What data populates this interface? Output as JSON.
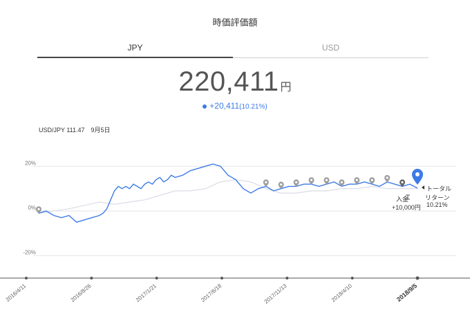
{
  "header": {
    "title": "時価評価額"
  },
  "tabs": [
    {
      "label": "JPY"
    },
    {
      "label": "USD"
    }
  ],
  "valuation": {
    "amount": "220,411",
    "unit": "円",
    "change": "+20,411",
    "change_pct": "(10.21%)"
  },
  "fx_rate": "USD/JPY 111.47　9月5日",
  "annotations": {
    "deposit_label": "入金",
    "deposit_amount": "+10,000円",
    "return_label_1": "トータル",
    "return_label_2": "リターン",
    "return_value": "10.21%"
  },
  "colors": {
    "accent": "#3d7be6",
    "benchmark": "#d9dce6",
    "grid": "#e6e6e6"
  },
  "icons": [
    "location-pin-icon",
    "deposit-icon",
    "arrow-left-icon"
  ],
  "chart_data": {
    "type": "line",
    "ylim": [
      -30,
      30
    ],
    "yticks": [
      "20%",
      "0%",
      "-20%"
    ],
    "ytick_values": [
      20,
      0,
      -20
    ],
    "x_ticks": [
      "2016/4/11",
      "2016/8/26",
      "2017/1/21",
      "2017/6/18",
      "2017/11/13",
      "2018/4/10",
      "2018/9/5"
    ],
    "series": [
      {
        "values_x": [
          0,
          2,
          4,
          6,
          8,
          10,
          12,
          14,
          16,
          17,
          18,
          19,
          20,
          21,
          22,
          23,
          24,
          25,
          26,
          27,
          28,
          29,
          30,
          31,
          32,
          33,
          34,
          35,
          36,
          38,
          40,
          42,
          44,
          46,
          48,
          50,
          52,
          54,
          56,
          58,
          60,
          62,
          64,
          66,
          68,
          70,
          72,
          74,
          76,
          78,
          80,
          82,
          84,
          86,
          88,
          90,
          92,
          94,
          96,
          98,
          100
        ],
        "values": [
          -1,
          0,
          -2,
          -3,
          -2,
          -5,
          -4,
          -3,
          -2,
          -1,
          1,
          5,
          9,
          11,
          10,
          11,
          10,
          12,
          11,
          10,
          12,
          13,
          12,
          14,
          15,
          13,
          14,
          16,
          15,
          16,
          18,
          19,
          20,
          21,
          20,
          16,
          14,
          10,
          8,
          10,
          11,
          9,
          10,
          11,
          11,
          12,
          12,
          11,
          12,
          13,
          11,
          12,
          12,
          13,
          12,
          11,
          13,
          12,
          11,
          12,
          10.21
        ]
      },
      {
        "values_x": [
          0,
          8,
          16,
          20,
          24,
          28,
          32,
          36,
          40,
          44,
          48,
          52,
          56,
          60,
          64,
          68,
          72,
          76,
          80,
          84,
          88,
          92,
          96,
          100
        ],
        "values": [
          -1,
          1,
          4,
          3,
          4,
          5,
          7,
          9,
          9,
          10,
          13,
          14,
          13,
          10,
          8,
          8,
          9,
          9,
          10,
          10,
          11,
          10,
          10,
          10
        ]
      }
    ],
    "x_range": [
      0,
      100
    ]
  }
}
